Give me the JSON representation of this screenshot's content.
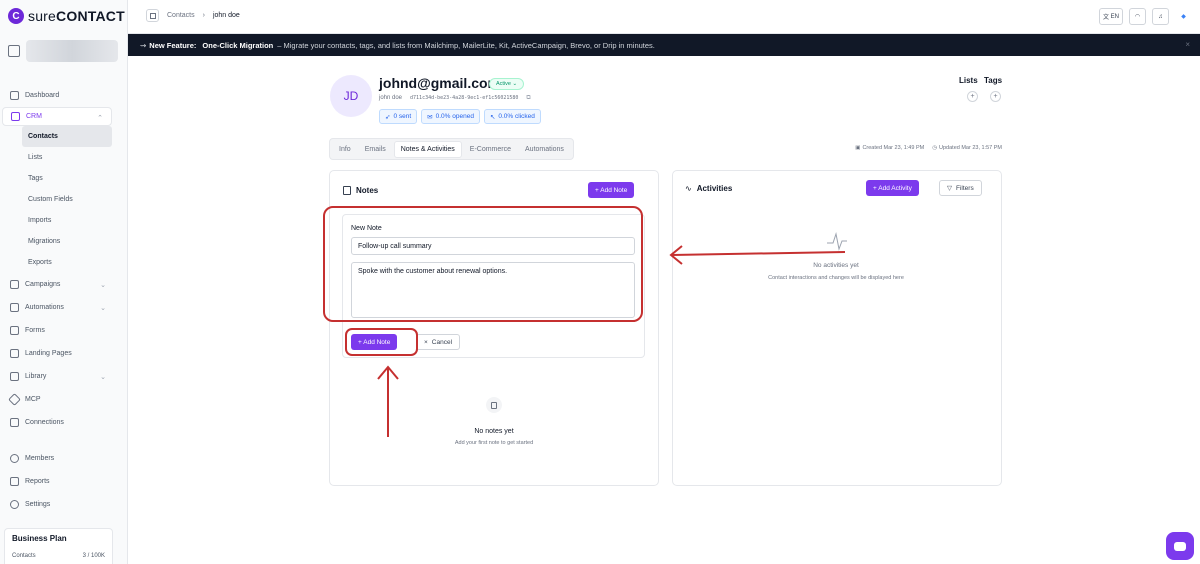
{
  "brand": {
    "logo_letter": "C",
    "name_light": "sure",
    "name_bold": "CONTACT"
  },
  "sidebar": {
    "items": [
      {
        "label": "Dashboard",
        "icon": "grid-icon"
      },
      {
        "label": "CRM",
        "icon": "crm-icon"
      },
      {
        "label": "Campaigns",
        "icon": "megaphone-icon"
      },
      {
        "label": "Automations",
        "icon": "flow-icon"
      },
      {
        "label": "Forms",
        "icon": "form-icon"
      },
      {
        "label": "Landing Pages",
        "icon": "page-icon"
      },
      {
        "label": "Library",
        "icon": "library-icon"
      },
      {
        "label": "MCP",
        "icon": "mcp-icon"
      },
      {
        "label": "Connections",
        "icon": "plug-icon"
      },
      {
        "label": "Members",
        "icon": "members-icon"
      },
      {
        "label": "Reports",
        "icon": "chart-icon"
      },
      {
        "label": "Settings",
        "icon": "gear-icon"
      }
    ],
    "crm_sub": [
      "Contacts",
      "Lists",
      "Tags",
      "Custom Fields",
      "Imports",
      "Migrations",
      "Exports"
    ],
    "plan": {
      "title": "Business Plan",
      "contacts_label": "Contacts",
      "contacts_value": "3 / 100K"
    }
  },
  "topbar": {
    "breadcrumb_root": "Contacts",
    "breadcrumb_sep": "›",
    "breadcrumb_current": "john doe",
    "lang": "EN"
  },
  "banner": {
    "prefix": "New Feature:",
    "bold": "One-Click Migration",
    "text": "– Migrate your contacts, tags, and lists from Mailchimp, MailerLite, Kit, ActiveCampaign, Brevo, or Drip in minutes.",
    "close": "×"
  },
  "contact": {
    "initials": "JD",
    "email": "johnd@gmail.com",
    "status": "Active ⌄",
    "name": "john doe",
    "uuid": "d711c34d-be23-4a28-9ec1-ef1c56021580",
    "stats": {
      "sent": "0 sent",
      "opened": "0.0% opened",
      "clicked": "0.0% clicked"
    },
    "lists_label": "Lists",
    "tags_label": "Tags"
  },
  "tabs": [
    "Info",
    "Emails",
    "Notes & Activities",
    "E-Commerce",
    "Automations"
  ],
  "meta": {
    "created": "Created Mar 23, 1:49 PM",
    "updated": "Updated Mar 23, 1:57 PM"
  },
  "notes": {
    "title": "Notes",
    "add_button": "+ Add Note",
    "form_label": "New Note",
    "title_value": "Follow-up call summary",
    "body_value": "Spoke with the customer about renewal options.",
    "submit": "+ Add Note",
    "cancel": "Cancel",
    "cancel_icon": "×",
    "empty_title": "No notes yet",
    "empty_sub": "Add your first note to get started"
  },
  "activities": {
    "title": "Activities",
    "add_button": "+ Add Activity",
    "filters": "Filters",
    "empty_title": "No activities yet",
    "empty_sub": "Contact interactions and changes will be displayed here"
  },
  "colors": {
    "accent": "#7c3aed",
    "annotation": "#c53030",
    "banner": "#111827"
  }
}
